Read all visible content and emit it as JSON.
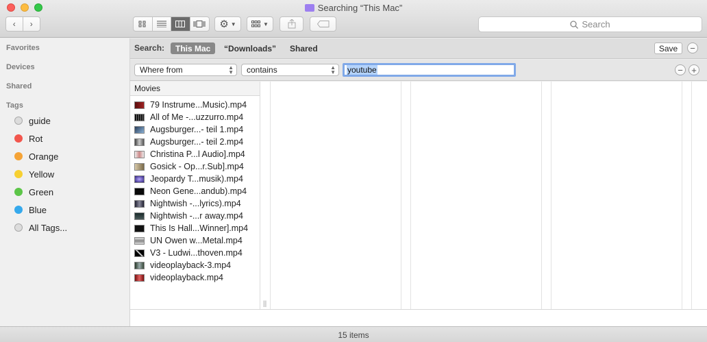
{
  "window": {
    "title": "Searching “This Mac”"
  },
  "search": {
    "placeholder": "Search"
  },
  "sidebar": {
    "favorites": "Favorites",
    "devices": "Devices",
    "shared": "Shared",
    "tags_header": "Tags",
    "tags": [
      {
        "label": "guide",
        "color": "#dcdcdc"
      },
      {
        "label": "Rot",
        "color": "#f2564d"
      },
      {
        "label": "Orange",
        "color": "#f5a336"
      },
      {
        "label": "Yellow",
        "color": "#f7d031"
      },
      {
        "label": "Green",
        "color": "#5cc548"
      },
      {
        "label": "Blue",
        "color": "#36a9ec"
      },
      {
        "label": "All Tags...",
        "color": "#dcdcdc"
      }
    ]
  },
  "scope": {
    "label": "Search:",
    "this_mac": "This Mac",
    "downloads": "“Downloads”",
    "shared": "Shared",
    "save": "Save",
    "minus": "−"
  },
  "criteria": {
    "attribute": "Where from",
    "operator": "contains",
    "value": "youtube",
    "minus": "−",
    "plus": "+"
  },
  "browser": {
    "column_header": "Movies",
    "files": [
      "79 Instrume...Music).mp4",
      "All of Me -...uzzurro.mp4",
      "Augsburger...- teil 1.mp4",
      "Augsburger...- teil 2.mp4",
      "Christina P...l Audio].mp4",
      "Gosick - Op...r.Sub].mp4",
      "Jeopardy T...musik).mp4",
      "Neon Gene...andub).mp4",
      "Nightwish -...lyrics).mp4",
      "Nightwish -...r away.mp4",
      "This Is Hall...Winner].mp4",
      "UN Owen w...Metal.mp4",
      "V3 - Ludwi...thoven.mp4",
      "videoplayback-3.mp4",
      "videoplayback.mp4"
    ]
  },
  "status": {
    "items": "15 items"
  }
}
